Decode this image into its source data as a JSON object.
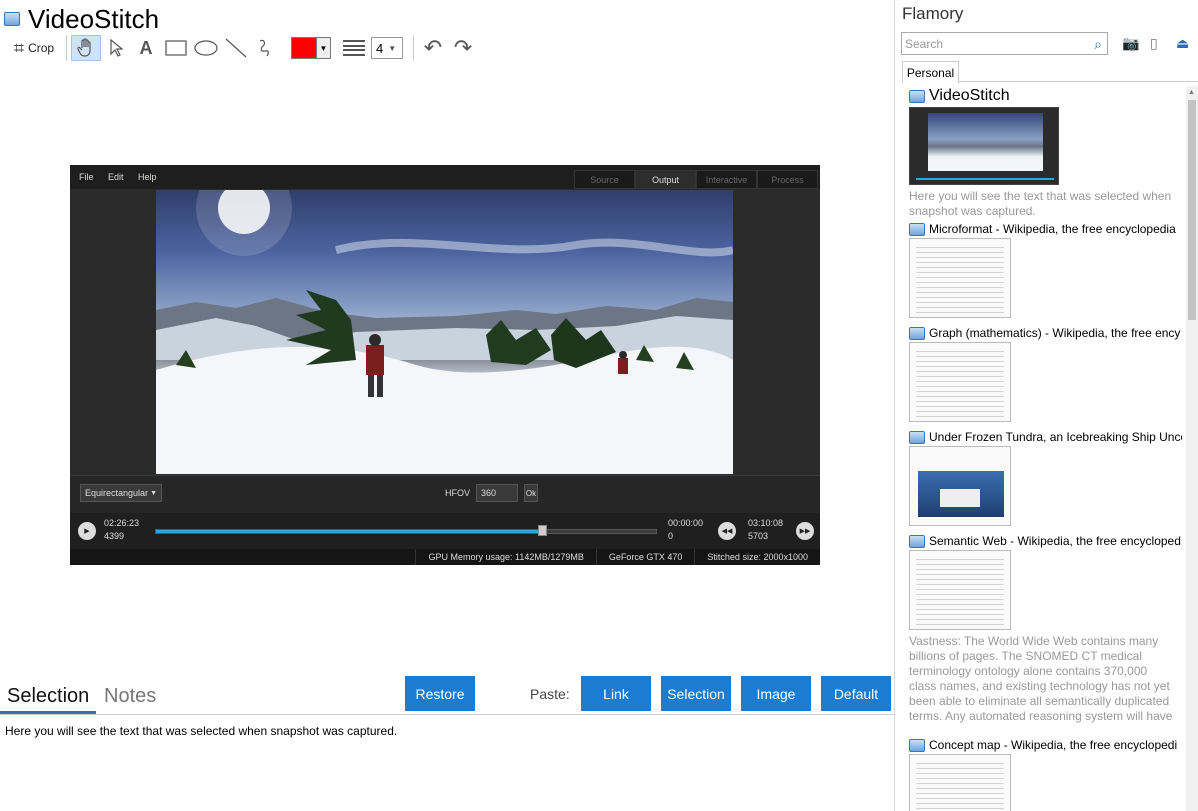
{
  "app": {
    "title": "VideoStitch"
  },
  "toolbar": {
    "crop_label": "Crop",
    "width_value": "4",
    "color": "#ff0000"
  },
  "screenshot": {
    "menu": [
      "File",
      "Edit",
      "Help"
    ],
    "tabs": [
      "Source",
      "Output",
      "Interactive",
      "Process"
    ],
    "projection": "Equirectangular",
    "hfov_label": "HFOV",
    "hfov_value": "360",
    "ok_label": "Ok",
    "time_current": "02:26:23",
    "frame_current": "4399",
    "time_start": "00:00:00",
    "frame_start": "0",
    "time_end": "03:10:08",
    "frame_end": "5703",
    "progress": 0.77,
    "status": {
      "gpu": "GPU Memory usage: 1142MB/1279MB",
      "gpu_name": "GeForce GTX 470",
      "stitched": "Stitched size: 2000x1000"
    }
  },
  "bottom": {
    "tabs": [
      "Selection",
      "Notes"
    ],
    "restore_label": "Restore",
    "paste_label": "Paste:",
    "paste_buttons": [
      "Link",
      "Selection",
      "Image",
      "Default"
    ],
    "selection_text": "Here you will see the text that was selected when snapshot was captured."
  },
  "panel": {
    "title": "Flamory",
    "search_placeholder": "Search",
    "tab": "Personal",
    "items": [
      {
        "title": "VideoStitch",
        "desc": "Here you will see the text that was selected when snapshot was captured."
      },
      {
        "title": "Microformat - Wikipedia, the free encyclopedia",
        "desc": ""
      },
      {
        "title": "Graph (mathematics) - Wikipedia, the free ency",
        "desc": ""
      },
      {
        "title": "Under Frozen Tundra, an Icebreaking Ship Unco",
        "desc": ""
      },
      {
        "title": "Semantic Web - Wikipedia, the free encycloped",
        "desc": "Vastness: The World Wide Web contains many billions of pages. The SNOMED CT medical terminology ontology alone contains 370,000 class names, and existing technology has not yet been able to eliminate all semantically duplicated terms. Any automated reasoning system will have to deal with truly huge inputs."
      },
      {
        "title": "Concept map - Wikipedia, the free encyclopedi",
        "desc": ""
      }
    ]
  }
}
